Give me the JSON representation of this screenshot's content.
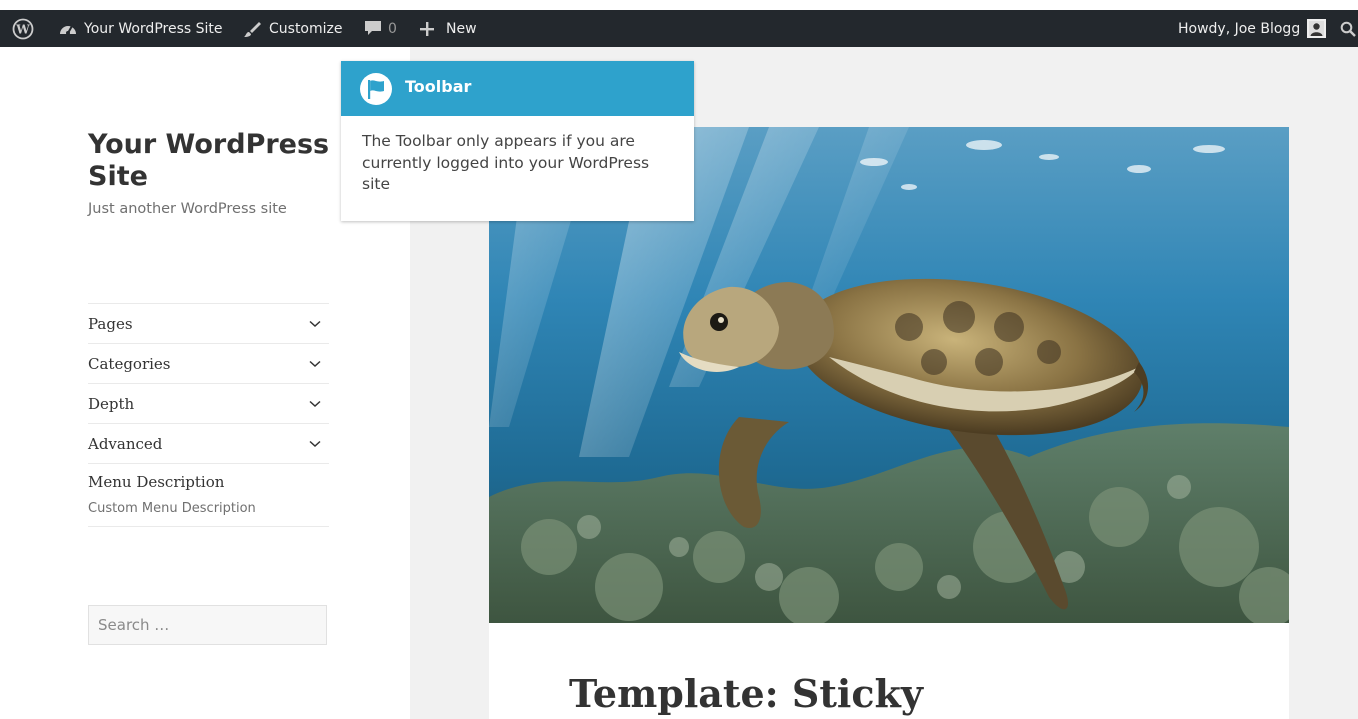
{
  "adminbar": {
    "wp_logo_icon": "wordpress-logo-icon",
    "site_name": "Your WordPress Site",
    "customize_label": "Customize",
    "comments_count": "0",
    "new_label": "New",
    "greeting": "Howdy, Joe Blogg",
    "bg_color": "#23282d"
  },
  "site": {
    "title": "Your WordPress Site",
    "description": "Just another WordPress site"
  },
  "menu": {
    "items": [
      {
        "label": "Pages"
      },
      {
        "label": "Categories"
      },
      {
        "label": "Depth"
      },
      {
        "label": "Advanced"
      }
    ],
    "description_item": {
      "title": "Menu Description",
      "subtitle": "Custom Menu Description"
    }
  },
  "search": {
    "placeholder": "Search …"
  },
  "tooltip": {
    "title": "Toolbar",
    "body": "The Toolbar only appears if you are currently logged into your WordPress site",
    "accent": "#2ea2cc"
  },
  "post": {
    "title": "Template: Sticky"
  }
}
